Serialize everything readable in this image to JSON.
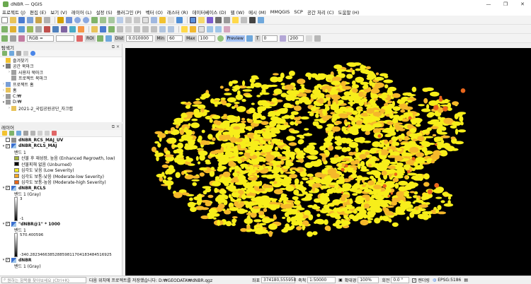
{
  "window": {
    "title": "dNBR — QGIS",
    "minimize": "—",
    "maximize": "❐",
    "close": "✕"
  },
  "menu": [
    "프로젝트 (J)",
    "편집 (E)",
    "보기 (V)",
    "레이어 (L)",
    "설정 (S)",
    "플러그인 (P)",
    "벡터 (O)",
    "래스터 (R)",
    "데이터베이스 (D)",
    "웹 (W)",
    "메시 (M)",
    "MMQGIS",
    "SCP",
    "공간 처리 (C)",
    "도움말 (H)"
  ],
  "scp_toolbar": {
    "band_set": "RGB =",
    "roi_button": "ROI",
    "dist_label": "Dist",
    "dist_value": "0.010000",
    "min_label": "Min",
    "min_value": "60",
    "max_label": "Max",
    "max_value": "100",
    "preview_label": "Preview",
    "t_label": "T",
    "t_value": "0",
    "s_value": "200"
  },
  "browser": {
    "title": "탐색기",
    "items": [
      {
        "arrow": "",
        "label": "즐겨찾기",
        "icon_color": "#f2c230",
        "indent": 0
      },
      {
        "arrow": "▾",
        "label": "공간 북마크",
        "icon_color": "#7a7a7a",
        "indent": 0
      },
      {
        "arrow": "›",
        "label": "사용자 북마크",
        "icon_color": "#a0a0a0",
        "indent": 1
      },
      {
        "arrow": "",
        "label": "프로젝트 북마크",
        "icon_color": "#a0a0a0",
        "indent": 1
      },
      {
        "arrow": "›",
        "label": "프로젝트 홈",
        "icon_color": "#7a9fd6",
        "indent": 0
      },
      {
        "arrow": "›",
        "label": "홈",
        "icon_color": "#e8c35a",
        "indent": 0
      },
      {
        "arrow": "›",
        "label": "C:₩",
        "icon_color": "#9a9a9a",
        "indent": 0
      },
      {
        "arrow": "▾",
        "label": "D:₩",
        "icon_color": "#9a9a9a",
        "indent": 0
      },
      {
        "arrow": "›",
        "label": "2021-2_국립공원공단_자크랩",
        "icon_color": "#e8c35a",
        "indent": 1
      }
    ]
  },
  "layers": {
    "title": "레이어",
    "rows": [
      {
        "type": "layer",
        "checked": false,
        "expanded": false,
        "label": "dNBR_RCS_MAJ_UV",
        "icon": "vector"
      },
      {
        "type": "layer",
        "checked": true,
        "expanded": true,
        "label": "dNBR_RCLS_MAJ",
        "icon": "raster"
      },
      {
        "type": "text",
        "label": "밴드 1"
      },
      {
        "type": "class",
        "color": "#a3b33c",
        "label": "산불 후 재성장, 높음 (Enhanced Regrowth, low)"
      },
      {
        "type": "class",
        "color": "#000000",
        "label": "산불피해 없음 (Unburned)"
      },
      {
        "type": "class",
        "color": "#f2ea1e",
        "label": "심각도 낮음 (Low Severity)"
      },
      {
        "type": "class",
        "color": "#f5a623",
        "label": "심각도 보통-낮음 (Moderate-low Severity)"
      },
      {
        "type": "class",
        "color": "#e8661c",
        "label": "심각도 보통-높음 (Moderate-high Severity)"
      },
      {
        "type": "layer",
        "checked": true,
        "expanded": true,
        "label": "dNBR_RCLS",
        "icon": "raster"
      },
      {
        "type": "text",
        "label": "밴드 1 (Gray)"
      },
      {
        "type": "ramp",
        "max": "3",
        "min": "-1"
      },
      {
        "type": "layer",
        "checked": true,
        "expanded": true,
        "label": "\"dNBR@1\" * 1000",
        "icon": "raster"
      },
      {
        "type": "text",
        "label": "밴드 1"
      },
      {
        "type": "ramp",
        "max": "570.400596",
        "min": "-340.282346638528859811704183484516925"
      },
      {
        "type": "layer",
        "checked": true,
        "expanded": true,
        "label": "dNBR",
        "icon": "raster"
      },
      {
        "type": "text",
        "label": "밴드 1 (Gray)"
      }
    ]
  },
  "status": {
    "locator_placeholder": "원하는 항목을 찾아보세요 (Ctrl+K)",
    "message": "다음 위치에 프로젝트를 저장했습니다: D:₩GEODATA₩dNBR.qgz",
    "coord_label": "좌표",
    "coord_value": "374180,555958",
    "scale_label": "축척",
    "scale_value": "1:50000",
    "mag_label": "확대경",
    "mag_value": "100%",
    "rot_label": "회전",
    "rot_value": "0.0 °",
    "render_label": "렌더링",
    "crs_label": "EPSG:5186"
  },
  "colors": {
    "low": "#f7ee1a",
    "moderate_low": "#f5b82a",
    "moderate_high": "#e8661c",
    "background": "#000000"
  }
}
